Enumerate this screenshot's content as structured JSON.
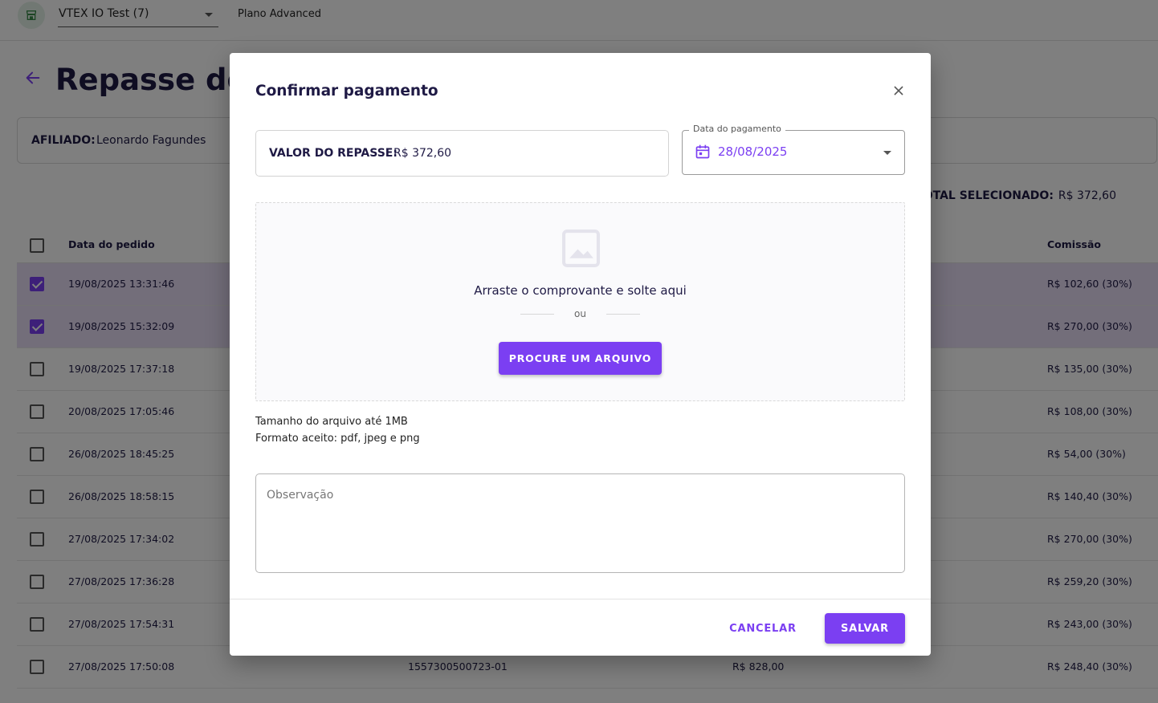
{
  "topbar": {
    "store_name": "VTEX IO Test (7)",
    "plan": "Plano Advanced"
  },
  "page": {
    "title": "Repasse de",
    "affiliate_label": "AFILIADO:",
    "affiliate_name": "Leonardo Fagundes",
    "total_selected_label": "OTAL SELECIONADO:",
    "total_selected_value": "R$ 372,60"
  },
  "table": {
    "headers": {
      "order_date": "Data do pedido",
      "commission": "Comissão"
    },
    "rows": [
      {
        "date": "19/08/2025 13:31:46",
        "order_id": "",
        "value": "",
        "commission": "R$ 102,60 (30%)",
        "checked": true
      },
      {
        "date": "19/08/2025 15:32:09",
        "order_id": "",
        "value": "",
        "commission": "R$ 270,00 (30%)",
        "checked": true
      },
      {
        "date": "19/08/2025 17:37:18",
        "order_id": "",
        "value": "",
        "commission": "R$ 135,00 (30%)",
        "checked": false
      },
      {
        "date": "20/08/2025 17:05:46",
        "order_id": "",
        "value": "",
        "commission": "R$ 108,00 (30%)",
        "checked": false
      },
      {
        "date": "26/08/2025 18:45:25",
        "order_id": "",
        "value": "",
        "commission": "R$ 54,00 (30%)",
        "checked": false
      },
      {
        "date": "26/08/2025 18:58:15",
        "order_id": "",
        "value": "",
        "commission": "R$ 140,40 (30%)",
        "checked": false
      },
      {
        "date": "27/08/2025 17:34:02",
        "order_id": "",
        "value": "",
        "commission": "R$ 270,00 (30%)",
        "checked": false
      },
      {
        "date": "27/08/2025 17:36:28",
        "order_id": "",
        "value": "",
        "commission": "R$ 259,20 (30%)",
        "checked": false
      },
      {
        "date": "27/08/2025 17:54:31",
        "order_id": "",
        "value": "",
        "commission": "R$ 243,00 (30%)",
        "checked": false
      },
      {
        "date": "27/08/2025 17:50:08",
        "order_id": "1557300500723-01",
        "value": "R$ 828,00",
        "commission": "R$ 248,40 (30%)",
        "checked": false
      }
    ]
  },
  "modal": {
    "title": "Confirmar pagamento",
    "valor_label": "VALOR DO REPASSE:",
    "valor_value": "R$ 372,60",
    "date_legend": "Data do pagamento",
    "date_value": "28/08/2025",
    "drop_text": "Arraste o comprovante e solte aqui",
    "or_text": "ou",
    "browse_label": "PROCURE UM ARQUIVO",
    "hint_size": "Tamanho do arquivo até 1MB",
    "hint_format": "Formato aceito: pdf, jpeg e png",
    "obs_placeholder": "Observação",
    "cancel_label": "CANCELAR",
    "save_label": "SALVAR"
  },
  "colors": {
    "accent": "#7b3ff2",
    "title_text": "#1f1a45",
    "selected_row": "#e6dcf5"
  }
}
